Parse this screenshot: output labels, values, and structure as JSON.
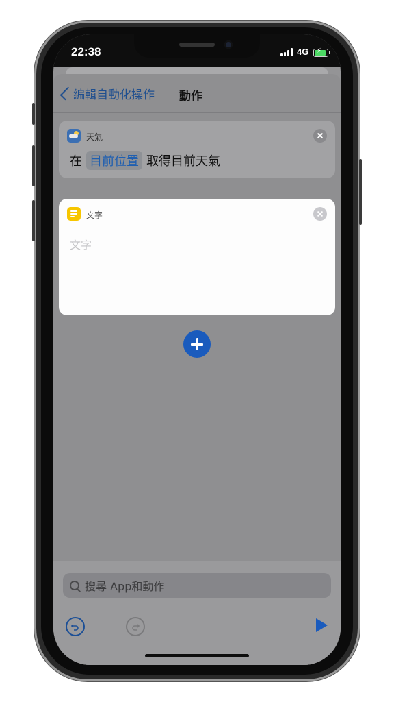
{
  "status_bar": {
    "time": "22:38",
    "network": "4G"
  },
  "nav": {
    "back_label": "編輯自動化操作",
    "title": "動作"
  },
  "weather_action": {
    "app_label": "天氣",
    "prefix": "在",
    "location_token": "目前位置",
    "action_text": "取得目前天氣"
  },
  "text_action": {
    "app_label": "文字",
    "placeholder": "文字"
  },
  "search": {
    "placeholder": "搜尋 App和動作"
  },
  "colors": {
    "accent": "#1a5bbd",
    "text_icon": "#f7c600",
    "weather_icon": "#3b6fb3"
  },
  "icons": {
    "back": "chevron-left-icon",
    "weather": "weather-icon",
    "text": "text-note-icon",
    "close": "close-icon",
    "add": "plus-icon",
    "search": "search-icon",
    "undo": "undo-icon",
    "redo": "redo-icon",
    "run": "play-icon"
  }
}
